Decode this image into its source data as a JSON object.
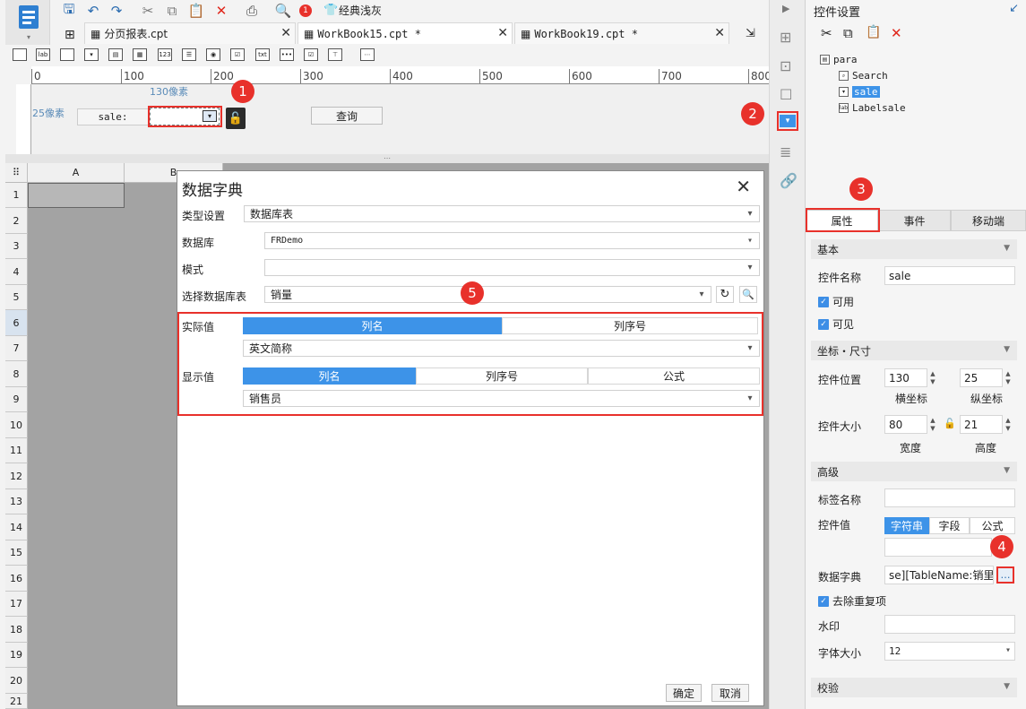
{
  "toolbar": {
    "theme_label": "经典浅灰",
    "alert_count": "1"
  },
  "tabs": [
    {
      "label": "分页报表.cpt"
    },
    {
      "label": "WorkBook15.cpt *"
    },
    {
      "label": "WorkBook19.cpt *"
    }
  ],
  "ruler": {
    "ticks": [
      "0",
      "100",
      "200",
      "300",
      "400",
      "500",
      "600",
      "700",
      "800"
    ]
  },
  "param": {
    "x_hint": "130像素",
    "y_hint": "25像素",
    "label": "sale:",
    "query_button": "查询"
  },
  "grid": {
    "columns": [
      "A",
      "B"
    ],
    "rows": [
      "1",
      "2",
      "3",
      "4",
      "5",
      "6",
      "7",
      "8",
      "9",
      "10",
      "11",
      "12",
      "13",
      "14",
      "15",
      "16",
      "17",
      "18",
      "19",
      "20",
      "21"
    ]
  },
  "callouts": [
    "1",
    "2",
    "3",
    "4",
    "5"
  ],
  "dialog": {
    "title": "数据字典",
    "type_label": "类型设置",
    "type_value": "数据库表",
    "db_label": "数据库",
    "db_value": "FRDemo",
    "schema_label": "模式",
    "schema_value": "",
    "table_label": "选择数据库表",
    "table_value": "销量",
    "actual_label": "实际值",
    "actual_seg": [
      "列名",
      "列序号"
    ],
    "actual_value": "英文简称",
    "display_label": "显示值",
    "display_seg": [
      "列名",
      "列序号",
      "公式"
    ],
    "display_value": "销售员",
    "ok": "确定",
    "cancel": "取消"
  },
  "panel": {
    "title": "控件设置",
    "tree": {
      "root": "para",
      "items": [
        "Search",
        "sale",
        "Labelsale"
      ]
    },
    "tabs": [
      "属性",
      "事件",
      "移动端"
    ],
    "sec_basic": "基本",
    "name_label": "控件名称",
    "name_value": "sale",
    "enabled": "可用",
    "visible": "可见",
    "sec_coord": "坐标・尺寸",
    "pos_label": "控件位置",
    "pos_x": "130",
    "pos_y": "25",
    "x_caption": "横坐标",
    "y_caption": "纵坐标",
    "size_label": "控件大小",
    "width": "80",
    "height": "21",
    "w_caption": "宽度",
    "h_caption": "高度",
    "sec_adv": "高级",
    "tag_label": "标签名称",
    "tag_value": "",
    "value_label": "控件值",
    "value_seg": [
      "字符串",
      "字段",
      "公式"
    ],
    "value_value": "",
    "dict_label": "数据字典",
    "dict_value": "se][TableName:销里]",
    "dict_more": "…",
    "dedupe": "去除重复项",
    "watermark_label": "水印",
    "watermark_value": "",
    "font_label": "字体大小",
    "font_value": "12",
    "sec_validate": "校验"
  }
}
